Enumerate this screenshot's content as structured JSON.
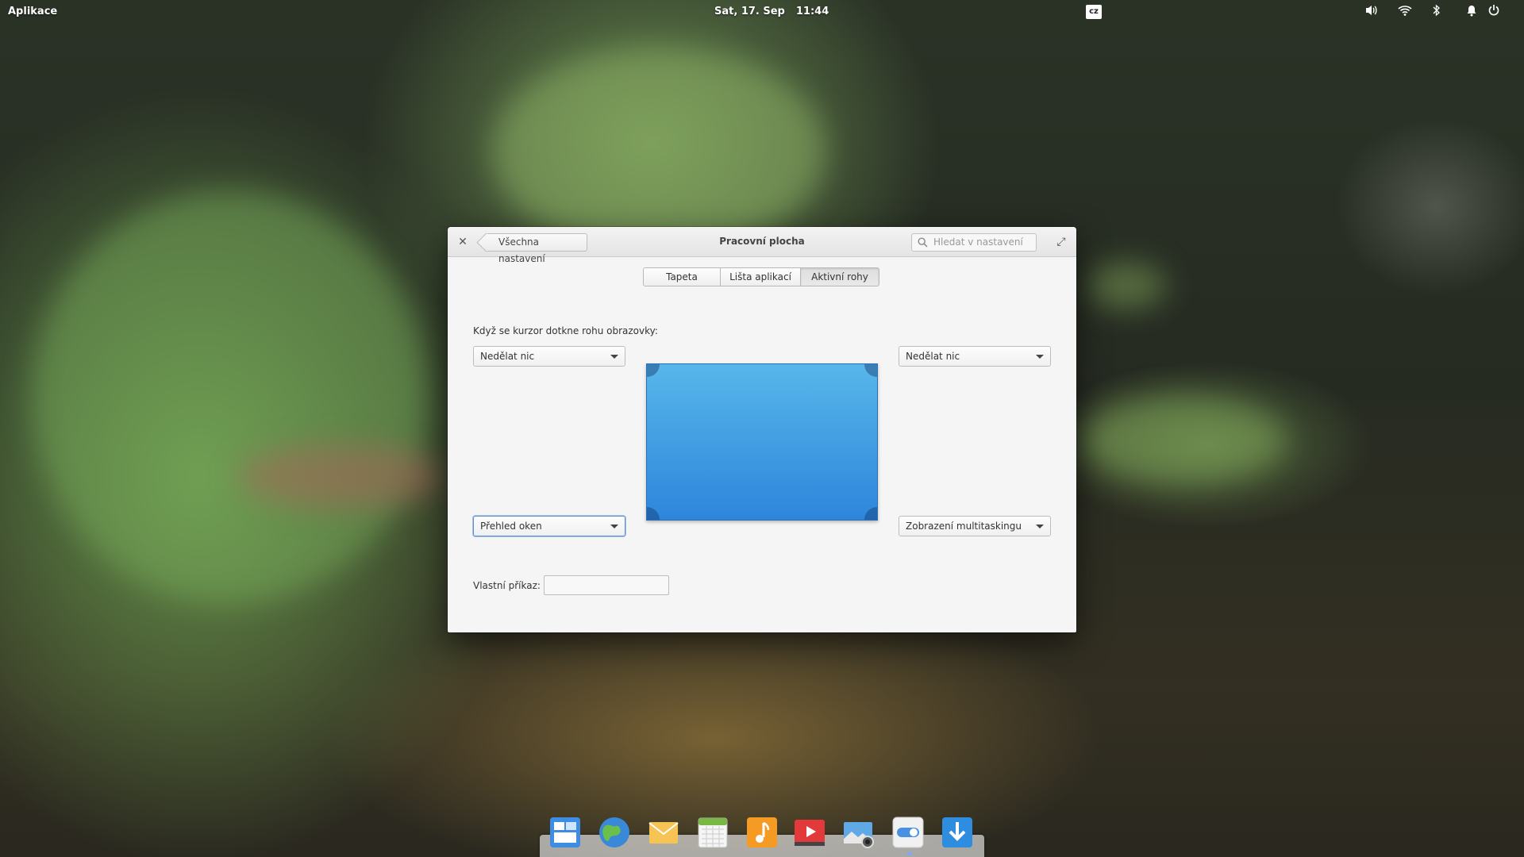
{
  "panel": {
    "applications_label": "Aplikace",
    "date": "Sat, 17. Sep",
    "time": "11:44",
    "keyboard_layout": "cz"
  },
  "window": {
    "title": "Pracovní plocha",
    "back_label": "Všechna nastavení",
    "search_placeholder": "Hledat v nastavení",
    "tabs": [
      {
        "label": "Tapeta"
      },
      {
        "label": "Lišta aplikací"
      },
      {
        "label": "Aktivní rohy"
      }
    ],
    "active_tab": "Aktivní rohy",
    "prompt": "Když se kurzor dotkne rohu obrazovky:",
    "corners": {
      "top_left": "Nedělat nic",
      "top_right": "Nedělat nic",
      "bottom_left": "Přehled oken",
      "bottom_right": "Zobrazení multitaskingu"
    },
    "custom_command_label": "Vlastní příkaz:",
    "custom_command_value": ""
  },
  "dock": {
    "icons": [
      "multitasking-icon",
      "web-browser-icon",
      "mail-icon",
      "calendar-icon",
      "music-icon",
      "videos-icon",
      "photos-icon",
      "system-settings-icon",
      "appcenter-icon"
    ]
  },
  "colors": {
    "preview_top": "#57b6ea",
    "preview_bottom": "#2e86db",
    "focus_ring": "#5b8fd6"
  }
}
